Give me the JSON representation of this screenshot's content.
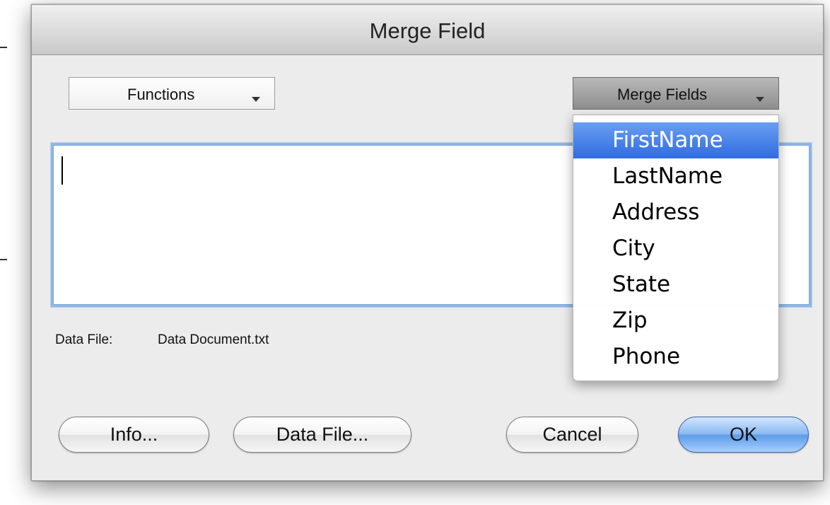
{
  "window": {
    "title": "Merge Field"
  },
  "functions_popup": {
    "label": "Functions"
  },
  "merge_fields_popup": {
    "label": "Merge Fields",
    "menu_items": [
      {
        "label": "FirstName",
        "selected": true
      },
      {
        "label": "LastName",
        "selected": false
      },
      {
        "label": "Address",
        "selected": false
      },
      {
        "label": "City",
        "selected": false
      },
      {
        "label": "State",
        "selected": false
      },
      {
        "label": "Zip",
        "selected": false
      },
      {
        "label": "Phone",
        "selected": false
      }
    ]
  },
  "formula_text": "",
  "data_file": {
    "label": "Data File:",
    "value": "Data Document.txt"
  },
  "buttons": {
    "info": "Info...",
    "data_file": "Data File...",
    "cancel": "Cancel",
    "ok": "OK"
  },
  "colors": {
    "selection": "#2f6cdf",
    "default_button": "#5e9be8",
    "focus_ring": "#8fb7e6"
  }
}
